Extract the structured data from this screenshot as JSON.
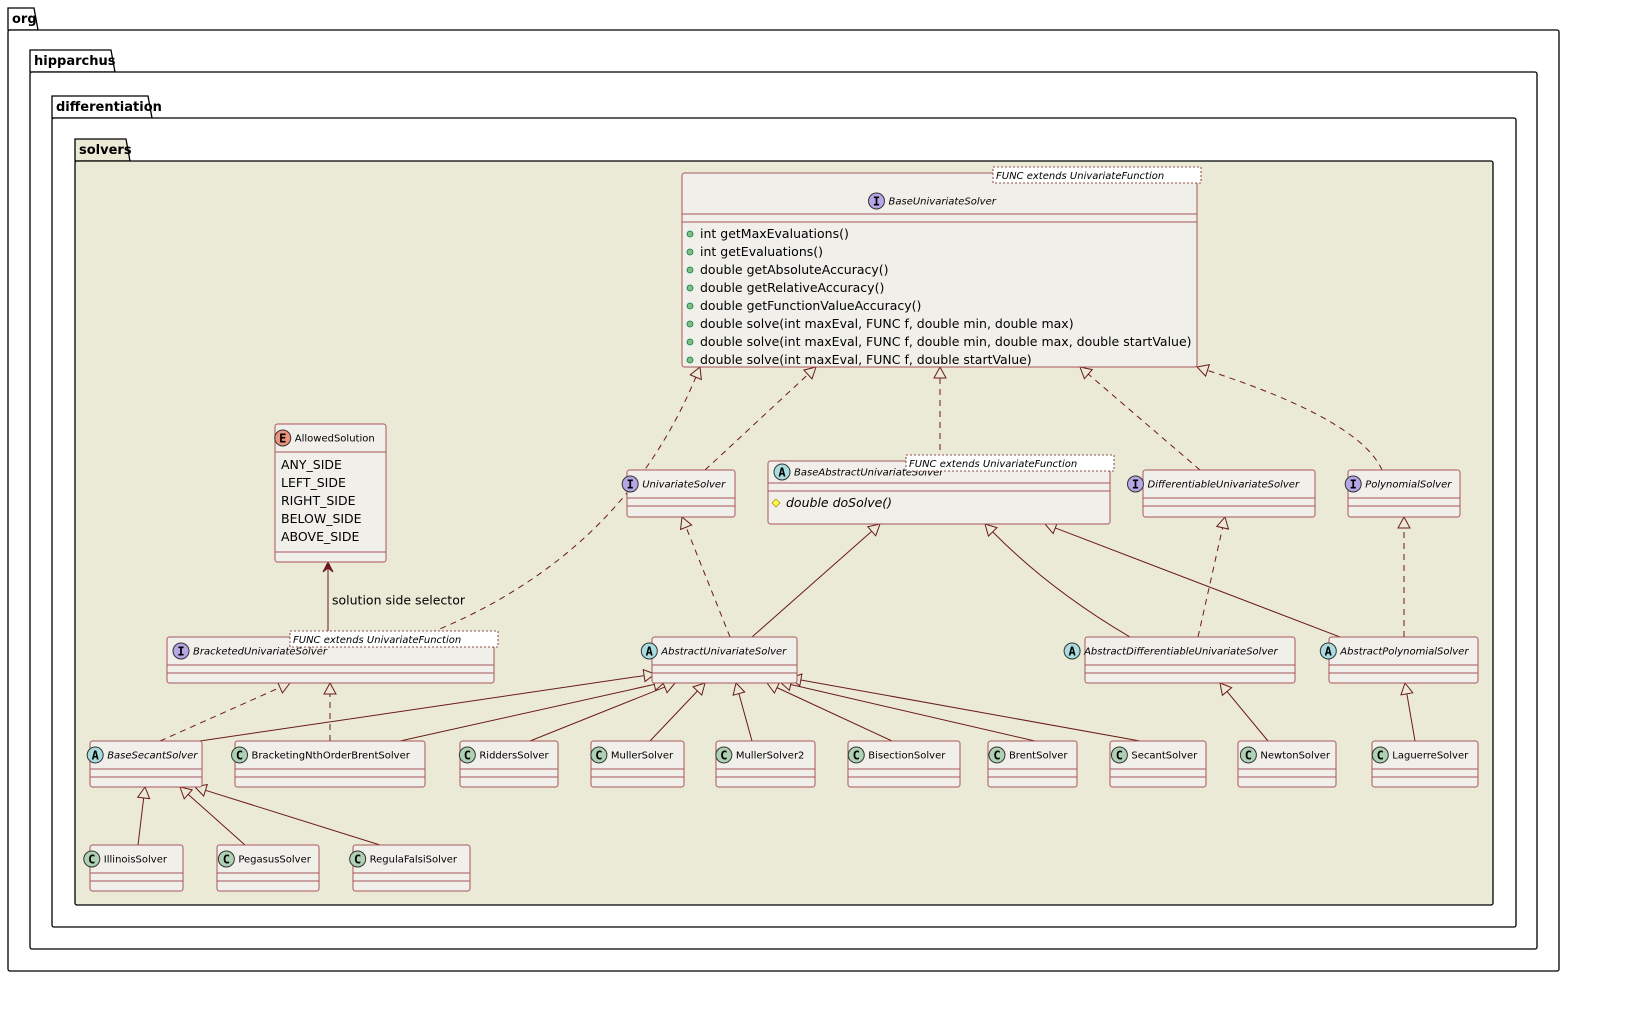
{
  "packages": [
    {
      "id": "org",
      "label": "org"
    },
    {
      "id": "hipparchus",
      "label": "hipparchus"
    },
    {
      "id": "differentiation",
      "label": "differentiation"
    },
    {
      "id": "solvers",
      "label": "solvers"
    }
  ],
  "colors": {
    "package_fill": "#EBEAD7",
    "class_fill": "#F1EFEA",
    "border": "#A8545A",
    "edge": "#6B1A1A",
    "interface_icon": "#B4A7E5",
    "abstract_icon": "#A9DCDF",
    "class_icon": "#ADD1B2",
    "enum_icon": "#EB937F",
    "public_dot": "#84BE84",
    "protected_diamond": "#FFFF44"
  },
  "classes": [
    {
      "id": "BaseUnivariateSolver",
      "kind": "interface",
      "icon": "I",
      "generic": "FUNC extends UnivariateFunction",
      "methods": [
        {
          "vis": "public",
          "text": "int getMaxEvaluations()"
        },
        {
          "vis": "public",
          "text": "int getEvaluations()"
        },
        {
          "vis": "public",
          "text": "double getAbsoluteAccuracy()"
        },
        {
          "vis": "public",
          "text": "double getRelativeAccuracy()"
        },
        {
          "vis": "public",
          "text": "double getFunctionValueAccuracy()"
        },
        {
          "vis": "public",
          "text": "double solve(int maxEval, FUNC f, double min, double max)"
        },
        {
          "vis": "public",
          "text": "double solve(int maxEval, FUNC f, double min, double max, double startValue)"
        },
        {
          "vis": "public",
          "text": "double solve(int maxEval, FUNC f, double startValue)"
        }
      ]
    },
    {
      "id": "AllowedSolution",
      "kind": "enum",
      "icon": "E",
      "values": [
        "ANY_SIDE",
        "LEFT_SIDE",
        "RIGHT_SIDE",
        "BELOW_SIDE",
        "ABOVE_SIDE"
      ]
    },
    {
      "id": "UnivariateSolver",
      "kind": "interface",
      "icon": "I"
    },
    {
      "id": "BaseAbstractUnivariateSolver",
      "kind": "abstract",
      "icon": "A",
      "generic": "FUNC extends UnivariateFunction",
      "methods": [
        {
          "vis": "protected",
          "text": "double doSolve()",
          "abstract": true
        }
      ]
    },
    {
      "id": "DifferentiableUnivariateSolver",
      "kind": "interface",
      "icon": "I"
    },
    {
      "id": "PolynomialSolver",
      "kind": "interface",
      "icon": "I"
    },
    {
      "id": "BracketedUnivariateSolver",
      "kind": "interface",
      "icon": "I",
      "generic": "FUNC extends UnivariateFunction"
    },
    {
      "id": "AbstractUnivariateSolver",
      "kind": "abstract",
      "icon": "A"
    },
    {
      "id": "AbstractDifferentiableUnivariateSolver",
      "kind": "abstract",
      "icon": "A"
    },
    {
      "id": "AbstractPolynomialSolver",
      "kind": "abstract",
      "icon": "A"
    },
    {
      "id": "BaseSecantSolver",
      "kind": "abstract",
      "icon": "A"
    },
    {
      "id": "BracketingNthOrderBrentSolver",
      "kind": "class",
      "icon": "C"
    },
    {
      "id": "RiddersSolver",
      "kind": "class",
      "icon": "C"
    },
    {
      "id": "MullerSolver",
      "kind": "class",
      "icon": "C"
    },
    {
      "id": "MullerSolver2",
      "kind": "class",
      "icon": "C"
    },
    {
      "id": "BisectionSolver",
      "kind": "class",
      "icon": "C"
    },
    {
      "id": "BrentSolver",
      "kind": "class",
      "icon": "C"
    },
    {
      "id": "SecantSolver",
      "kind": "class",
      "icon": "C"
    },
    {
      "id": "NewtonSolver",
      "kind": "class",
      "icon": "C"
    },
    {
      "id": "LaguerreSolver",
      "kind": "class",
      "icon": "C"
    },
    {
      "id": "IllinoisSolver",
      "kind": "class",
      "icon": "C"
    },
    {
      "id": "PegasusSolver",
      "kind": "class",
      "icon": "C"
    },
    {
      "id": "RegulaFalsiSolver",
      "kind": "class",
      "icon": "C"
    }
  ],
  "relations": [
    {
      "from": "UnivariateSolver",
      "to": "BaseUnivariateSolver",
      "type": "realization"
    },
    {
      "from": "BaseAbstractUnivariateSolver",
      "to": "BaseUnivariateSolver",
      "type": "realization"
    },
    {
      "from": "DifferentiableUnivariateSolver",
      "to": "BaseUnivariateSolver",
      "type": "realization"
    },
    {
      "from": "PolynomialSolver",
      "to": "BaseUnivariateSolver",
      "type": "realization"
    },
    {
      "from": "BracketedUnivariateSolver",
      "to": "BaseUnivariateSolver",
      "type": "realization"
    },
    {
      "from": "AbstractUnivariateSolver",
      "to": "UnivariateSolver",
      "type": "realization"
    },
    {
      "from": "AbstractUnivariateSolver",
      "to": "BaseAbstractUnivariateSolver",
      "type": "generalization"
    },
    {
      "from": "AbstractDifferentiableUnivariateSolver",
      "to": "BaseAbstractUnivariateSolver",
      "type": "generalization"
    },
    {
      "from": "AbstractDifferentiableUnivariateSolver",
      "to": "DifferentiableUnivariateSolver",
      "type": "realization"
    },
    {
      "from": "AbstractPolynomialSolver",
      "to": "BaseAbstractUnivariateSolver",
      "type": "generalization"
    },
    {
      "from": "AbstractPolynomialSolver",
      "to": "PolynomialSolver",
      "type": "realization"
    },
    {
      "from": "BracketedUnivariateSolver",
      "to": "AllowedSolution",
      "type": "association",
      "label": "solution side selector"
    },
    {
      "from": "BaseSecantSolver",
      "to": "BracketedUnivariateSolver",
      "type": "realization"
    },
    {
      "from": "BaseSecantSolver",
      "to": "AbstractUnivariateSolver",
      "type": "generalization"
    },
    {
      "from": "BracketingNthOrderBrentSolver",
      "to": "BracketedUnivariateSolver",
      "type": "realization"
    },
    {
      "from": "BracketingNthOrderBrentSolver",
      "to": "AbstractUnivariateSolver",
      "type": "generalization"
    },
    {
      "from": "RiddersSolver",
      "to": "AbstractUnivariateSolver",
      "type": "generalization"
    },
    {
      "from": "MullerSolver",
      "to": "AbstractUnivariateSolver",
      "type": "generalization"
    },
    {
      "from": "MullerSolver2",
      "to": "AbstractUnivariateSolver",
      "type": "generalization"
    },
    {
      "from": "BisectionSolver",
      "to": "AbstractUnivariateSolver",
      "type": "generalization"
    },
    {
      "from": "BrentSolver",
      "to": "AbstractUnivariateSolver",
      "type": "generalization"
    },
    {
      "from": "SecantSolver",
      "to": "AbstractUnivariateSolver",
      "type": "generalization"
    },
    {
      "from": "NewtonSolver",
      "to": "AbstractDifferentiableUnivariateSolver",
      "type": "generalization"
    },
    {
      "from": "LaguerreSolver",
      "to": "AbstractPolynomialSolver",
      "type": "generalization"
    },
    {
      "from": "IllinoisSolver",
      "to": "BaseSecantSolver",
      "type": "generalization"
    },
    {
      "from": "PegasusSolver",
      "to": "BaseSecantSolver",
      "type": "generalization"
    },
    {
      "from": "RegulaFalsiSolver",
      "to": "BaseSecantSolver",
      "type": "generalization"
    }
  ]
}
